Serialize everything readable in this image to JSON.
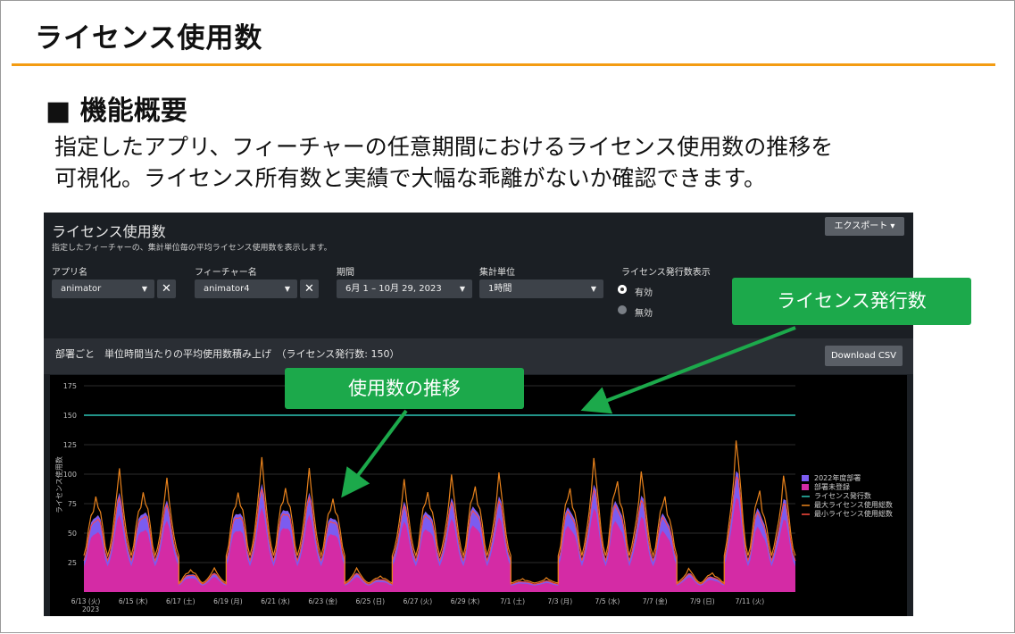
{
  "slide": {
    "title": "ライセンス使用数",
    "section_heading": "■ 機能概要",
    "description_line1": "指定したアプリ、フィーチャーの任意期間におけるライセンス使用数の推移を",
    "description_line2": "可視化。ライセンス所有数と実績で大幅な乖離がないか確認できます。"
  },
  "panel": {
    "title": "ライセンス使用数",
    "subtitle": "指定したフィーチャーの、集計単位毎の平均ライセンス使用数を表示します。",
    "export_label": "エクスポート ▾",
    "filters": {
      "app_label": "アプリ名",
      "app_value": "animator",
      "feature_label": "フィーチャー名",
      "feature_value": "animator4",
      "period_label": "期間",
      "period_value": "6月 1 – 10月 29, 2023",
      "unit_label": "集計単位",
      "unit_value": "1時間",
      "issued_label": "ライセンス発行数表示",
      "issued_on": "有効",
      "issued_off": "無効"
    },
    "chart_title": "部署ごと　単位時間当たりの平均使用数積み上げ　（ライセンス発行数: 150）",
    "download_label": "Download CSV"
  },
  "callouts": {
    "issued": "ライセンス発行数",
    "trend": "使用数の推移"
  },
  "colors": {
    "accent_rule": "#f39c12",
    "callout_green": "#1ca94b",
    "series_2022": "#7b5cf0",
    "series_unregistered": "#d42ba5",
    "series_issued": "#2ec4b6",
    "series_max": "#e8821c",
    "series_min": "#ff4a3d"
  },
  "chart_data": {
    "type": "area",
    "ylabel": "ライセンス使用数",
    "ylim": [
      0,
      175
    ],
    "yticks": [
      "175",
      "150",
      "125",
      "100",
      "75",
      "50",
      "25"
    ],
    "ytick_values": [
      175,
      150,
      125,
      100,
      75,
      50,
      25
    ],
    "xticks": [
      "6/13 (火)",
      "6/15 (木)",
      "6/17 (土)",
      "6/19 (月)",
      "6/21 (水)",
      "6/23 (金)",
      "6/25 (日)",
      "6/27 (火)",
      "6/29 (木)",
      "7/1 (土)",
      "7/3 (月)",
      "7/5 (水)",
      "7/7 (金)",
      "7/9 (日)",
      "7/11 (火)"
    ],
    "x_year_label": "2023",
    "issued_licenses": 150,
    "legend": [
      "2022年度部署",
      "部署未登録",
      "ライセンス発行数",
      "最大ライセンス使用総数",
      "最小ライセンス使用総数"
    ],
    "daily_peaks": [
      {
        "date": "6/13",
        "max": 95
      },
      {
        "date": "6/14",
        "max": 103
      },
      {
        "date": "6/15",
        "max": 100
      },
      {
        "date": "6/16",
        "max": 95
      },
      {
        "date": "6/17",
        "max": 22
      },
      {
        "date": "6/18",
        "max": 20
      },
      {
        "date": "6/19",
        "max": 100
      },
      {
        "date": "6/20",
        "max": 112
      },
      {
        "date": "6/21",
        "max": 105
      },
      {
        "date": "6/22",
        "max": 103
      },
      {
        "date": "6/23",
        "max": 93
      },
      {
        "date": "6/24",
        "max": 20
      },
      {
        "date": "6/25",
        "max": 15
      },
      {
        "date": "6/26",
        "max": 94
      },
      {
        "date": "6/27",
        "max": 100
      },
      {
        "date": "6/28",
        "max": 98
      },
      {
        "date": "6/29",
        "max": 106
      },
      {
        "date": "6/30",
        "max": 100
      },
      {
        "date": "7/1",
        "max": 12
      },
      {
        "date": "7/2",
        "max": 12
      },
      {
        "date": "7/3",
        "max": 103
      },
      {
        "date": "7/4",
        "max": 113
      },
      {
        "date": "7/5",
        "max": 110
      },
      {
        "date": "7/6",
        "max": 102
      },
      {
        "date": "7/7",
        "max": 93
      },
      {
        "date": "7/8",
        "max": 20
      },
      {
        "date": "7/9",
        "max": 18
      },
      {
        "date": "7/10",
        "max": 130
      },
      {
        "date": "7/11",
        "max": 98
      },
      {
        "date": "7/12",
        "max": 100
      }
    ]
  }
}
